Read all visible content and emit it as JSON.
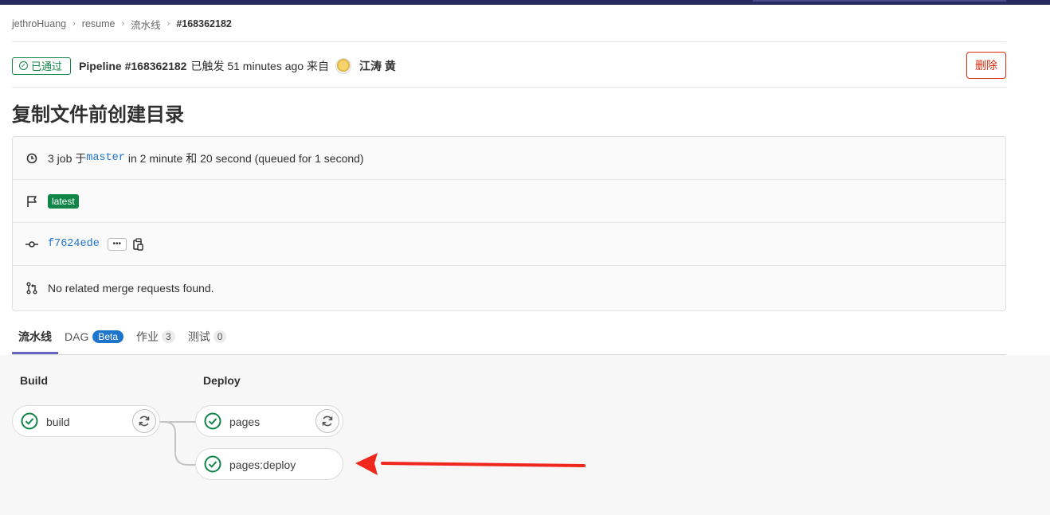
{
  "breadcrumb": {
    "items": [
      "jethroHuang",
      "resume",
      "流水线"
    ],
    "current": "#168362182"
  },
  "header": {
    "status": "已通过",
    "pipeline_id": "Pipeline #168362182",
    "triggered": "已触发 51 minutes ago 来自",
    "author": "江涛 黄",
    "delete_label": "删除"
  },
  "title": "复制文件前创建目录",
  "info": {
    "jobs_prefix": "3 job 于",
    "branch": "master",
    "duration_suffix": "in 2 minute 和 20 second (queued for 1 second)",
    "latest_label": "latest",
    "commit_sha": "f7624ede",
    "ellipsis": "•••",
    "merge_requests": "No related merge requests found."
  },
  "tabs": [
    {
      "label": "流水线"
    },
    {
      "label": "DAG",
      "badge": "Beta"
    },
    {
      "label": "作业",
      "count": "3"
    },
    {
      "label": "测试",
      "count": "0"
    }
  ],
  "stages": [
    {
      "title": "Build",
      "jobs": [
        {
          "name": "build",
          "status": "success"
        }
      ]
    },
    {
      "title": "Deploy",
      "jobs": [
        {
          "name": "pages",
          "status": "success"
        },
        {
          "name": "pages:deploy",
          "status": "success"
        }
      ]
    }
  ],
  "colors": {
    "success": "#108548",
    "danger": "#dd2b0e",
    "link": "#1f75cb",
    "annotation_arrow": "#f0271c"
  }
}
